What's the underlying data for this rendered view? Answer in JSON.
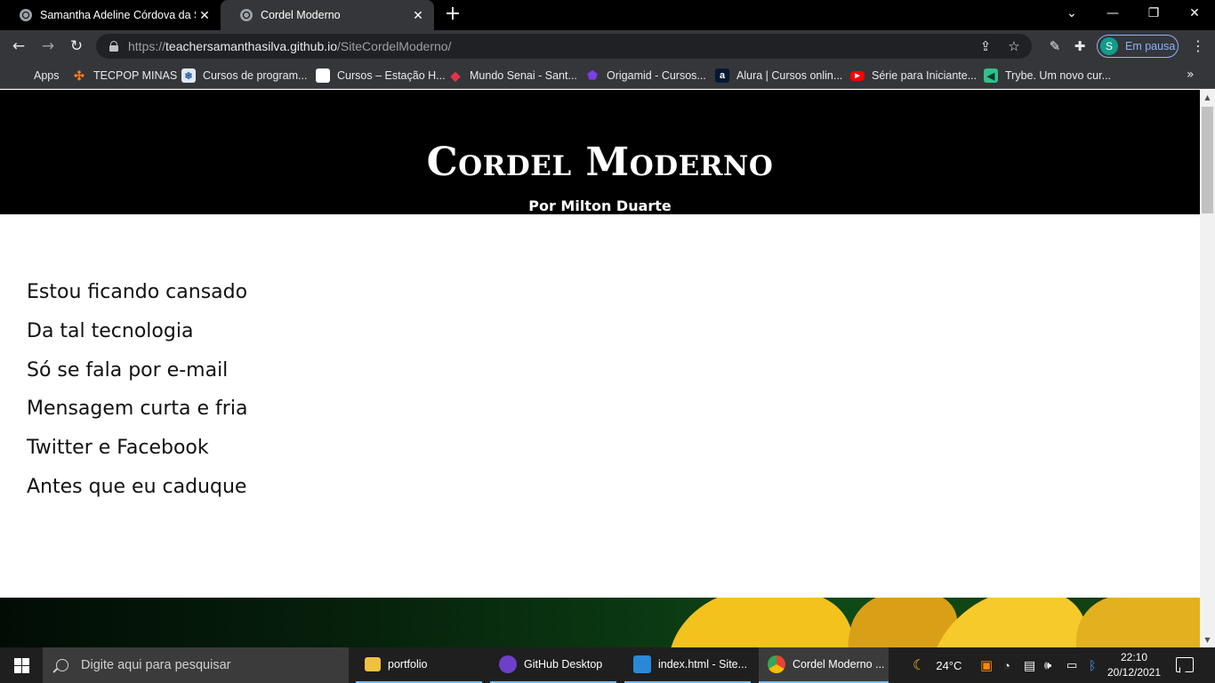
{
  "browser": {
    "tabs": [
      {
        "title": "Samantha Adeline Córdova da Si",
        "close": "✕"
      },
      {
        "title": "Cordel Moderno",
        "close": "✕"
      }
    ],
    "new_tab": "+",
    "window_controls": [
      "⌄",
      "—",
      "❐",
      "✕"
    ],
    "nav": {
      "back": "←",
      "forward": "→",
      "reload": "↻"
    },
    "address": {
      "scheme": "https://",
      "host": "teachersamanthasilva.github.io",
      "path": "/SiteCordelModerno/"
    },
    "profile": {
      "initial": "S",
      "status": "Em pausa"
    },
    "menu": "⋮",
    "bookmarks": [
      {
        "label": "Apps",
        "icon": "apps-grid-icon",
        "color": "#e94235"
      },
      {
        "label": "TECPOP MINAS",
        "icon": "tecpop-icon",
        "color": "#ff7a1a"
      },
      {
        "label": "Cursos de program...",
        "icon": "cursos-icon",
        "color": "#4a90d9"
      },
      {
        "label": "Cursos – Estação H...",
        "icon": "estacao-icon",
        "color": "#ffffff"
      },
      {
        "label": "Mundo Senai - Sant...",
        "icon": "senai-icon",
        "color": "#e8334a"
      },
      {
        "label": "Origamid - Cursos...",
        "icon": "origamid-icon",
        "color": "#7b3fe4"
      },
      {
        "label": "Alura | Cursos onlin...",
        "icon": "alura-icon",
        "color": "#051933"
      },
      {
        "label": "Série para Iniciante...",
        "icon": "youtube-icon",
        "color": "#ff0000"
      },
      {
        "label": "Trybe. Um novo cur...",
        "icon": "trybe-icon",
        "color": "#2fc18c"
      }
    ],
    "bookmarks_more": "»"
  },
  "page": {
    "title": "Cordel Moderno",
    "subtitle": "Por Milton Duarte",
    "poem": [
      "Estou ficando cansado",
      "Da tal tecnologia",
      "Só se fala por e-mail",
      "Mensagem curta e fria",
      "Twitter e Facebook",
      "Antes que eu caduque"
    ]
  },
  "taskbar": {
    "search_placeholder": "Digite aqui para pesquisar",
    "tasks": [
      {
        "label": "portfolio",
        "icon": "folder-icon",
        "color": "#f0c040"
      },
      {
        "label": "GitHub Desktop",
        "icon": "github-icon",
        "color": "#6e40c9"
      },
      {
        "label": "index.html - Site...",
        "icon": "vscode-icon",
        "color": "#2b88d8"
      },
      {
        "label": "Cordel Moderno ...",
        "icon": "chrome-icon",
        "color": "#dd4b39"
      }
    ],
    "weather": "24°C",
    "time": "22:10",
    "date": "20/12/2021"
  }
}
